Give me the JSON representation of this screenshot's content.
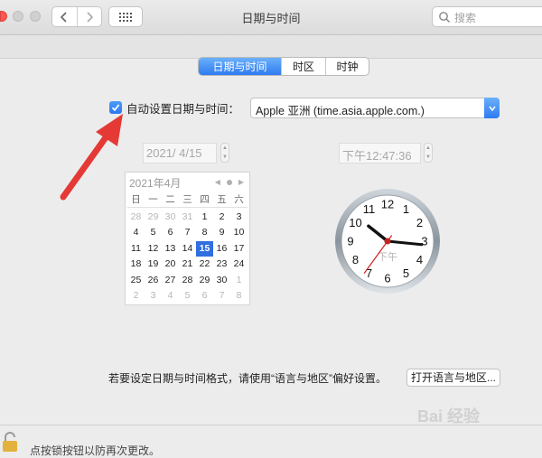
{
  "window": {
    "title": "日期与时间"
  },
  "search": {
    "placeholder": "搜索"
  },
  "tabs": [
    {
      "label": "日期与时间",
      "active": true
    },
    {
      "label": "时区",
      "active": false
    },
    {
      "label": "时钟",
      "active": false
    }
  ],
  "auto_set": {
    "label": "自动设置日期与时间：",
    "checked": true
  },
  "time_server": {
    "value": "Apple 亚洲 (time.asia.apple.com.)"
  },
  "date_field": {
    "value": "2021/  4/15"
  },
  "time_field": {
    "value": "下午12:47:36"
  },
  "calendar": {
    "month_label": "2021年4月",
    "weekdays": [
      "日",
      "一",
      "二",
      "三",
      "四",
      "五",
      "六"
    ],
    "days": [
      {
        "d": "28",
        "other": true
      },
      {
        "d": "29",
        "other": true
      },
      {
        "d": "30",
        "other": true
      },
      {
        "d": "31",
        "other": true
      },
      {
        "d": "1"
      },
      {
        "d": "2"
      },
      {
        "d": "3"
      },
      {
        "d": "4"
      },
      {
        "d": "5"
      },
      {
        "d": "6"
      },
      {
        "d": "7"
      },
      {
        "d": "8"
      },
      {
        "d": "9"
      },
      {
        "d": "10"
      },
      {
        "d": "11"
      },
      {
        "d": "12"
      },
      {
        "d": "13"
      },
      {
        "d": "14"
      },
      {
        "d": "15",
        "today": true
      },
      {
        "d": "16"
      },
      {
        "d": "17"
      },
      {
        "d": "18"
      },
      {
        "d": "19"
      },
      {
        "d": "20"
      },
      {
        "d": "21"
      },
      {
        "d": "22"
      },
      {
        "d": "23"
      },
      {
        "d": "24"
      },
      {
        "d": "25"
      },
      {
        "d": "26"
      },
      {
        "d": "27"
      },
      {
        "d": "28"
      },
      {
        "d": "29"
      },
      {
        "d": "30"
      },
      {
        "d": "1",
        "other": true
      },
      {
        "d": "2",
        "other": true
      },
      {
        "d": "3",
        "other": true
      },
      {
        "d": "4",
        "other": true
      },
      {
        "d": "5",
        "other": true
      },
      {
        "d": "6",
        "other": true
      },
      {
        "d": "7",
        "other": true
      },
      {
        "d": "8",
        "other": true
      }
    ]
  },
  "clock": {
    "hour": 12,
    "minute": 47,
    "second": 36,
    "period_label": "下午",
    "numerals": [
      "12",
      "1",
      "2",
      "3",
      "4",
      "5",
      "6",
      "7",
      "8",
      "9",
      "10",
      "11"
    ]
  },
  "format_note": "若要设定日期与时间格式，请使用“语言与地区”偏好设置。",
  "open_region_button": "打开语言与地区...",
  "lock_text": "点按锁按钮以防再次更改。",
  "watermark": "Bai 经验",
  "colors": {
    "accent": "#2f7bf0",
    "annotation_arrow": "#e53935"
  }
}
